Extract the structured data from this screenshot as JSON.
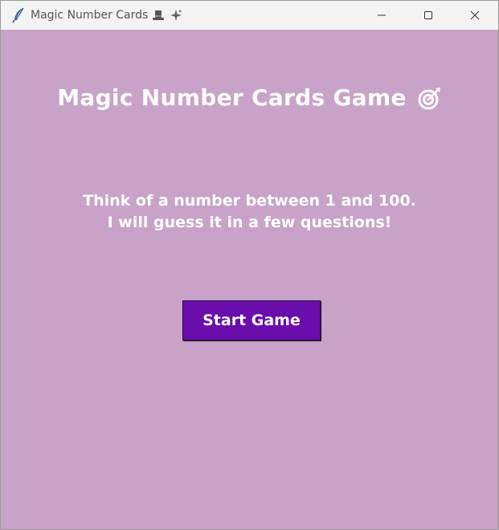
{
  "window": {
    "title": "Magic Number Cards",
    "title_emojis": [
      "top-hat-icon",
      "sparkles-icon"
    ],
    "app_icon": "feather-icon",
    "controls": [
      "minimize-icon",
      "maximize-icon",
      "close-icon"
    ]
  },
  "colors": {
    "background": "#c8a2c8",
    "titlebar": "#f3f3f3",
    "button": "#6a0dad",
    "text": "#ffffff"
  },
  "main": {
    "heading": "Magic Number Cards Game",
    "heading_icon": "target-icon",
    "instructions": [
      "Think of a number between 1 and 100.",
      "I will guess it in a few questions!"
    ],
    "start_button_label": "Start Game"
  }
}
